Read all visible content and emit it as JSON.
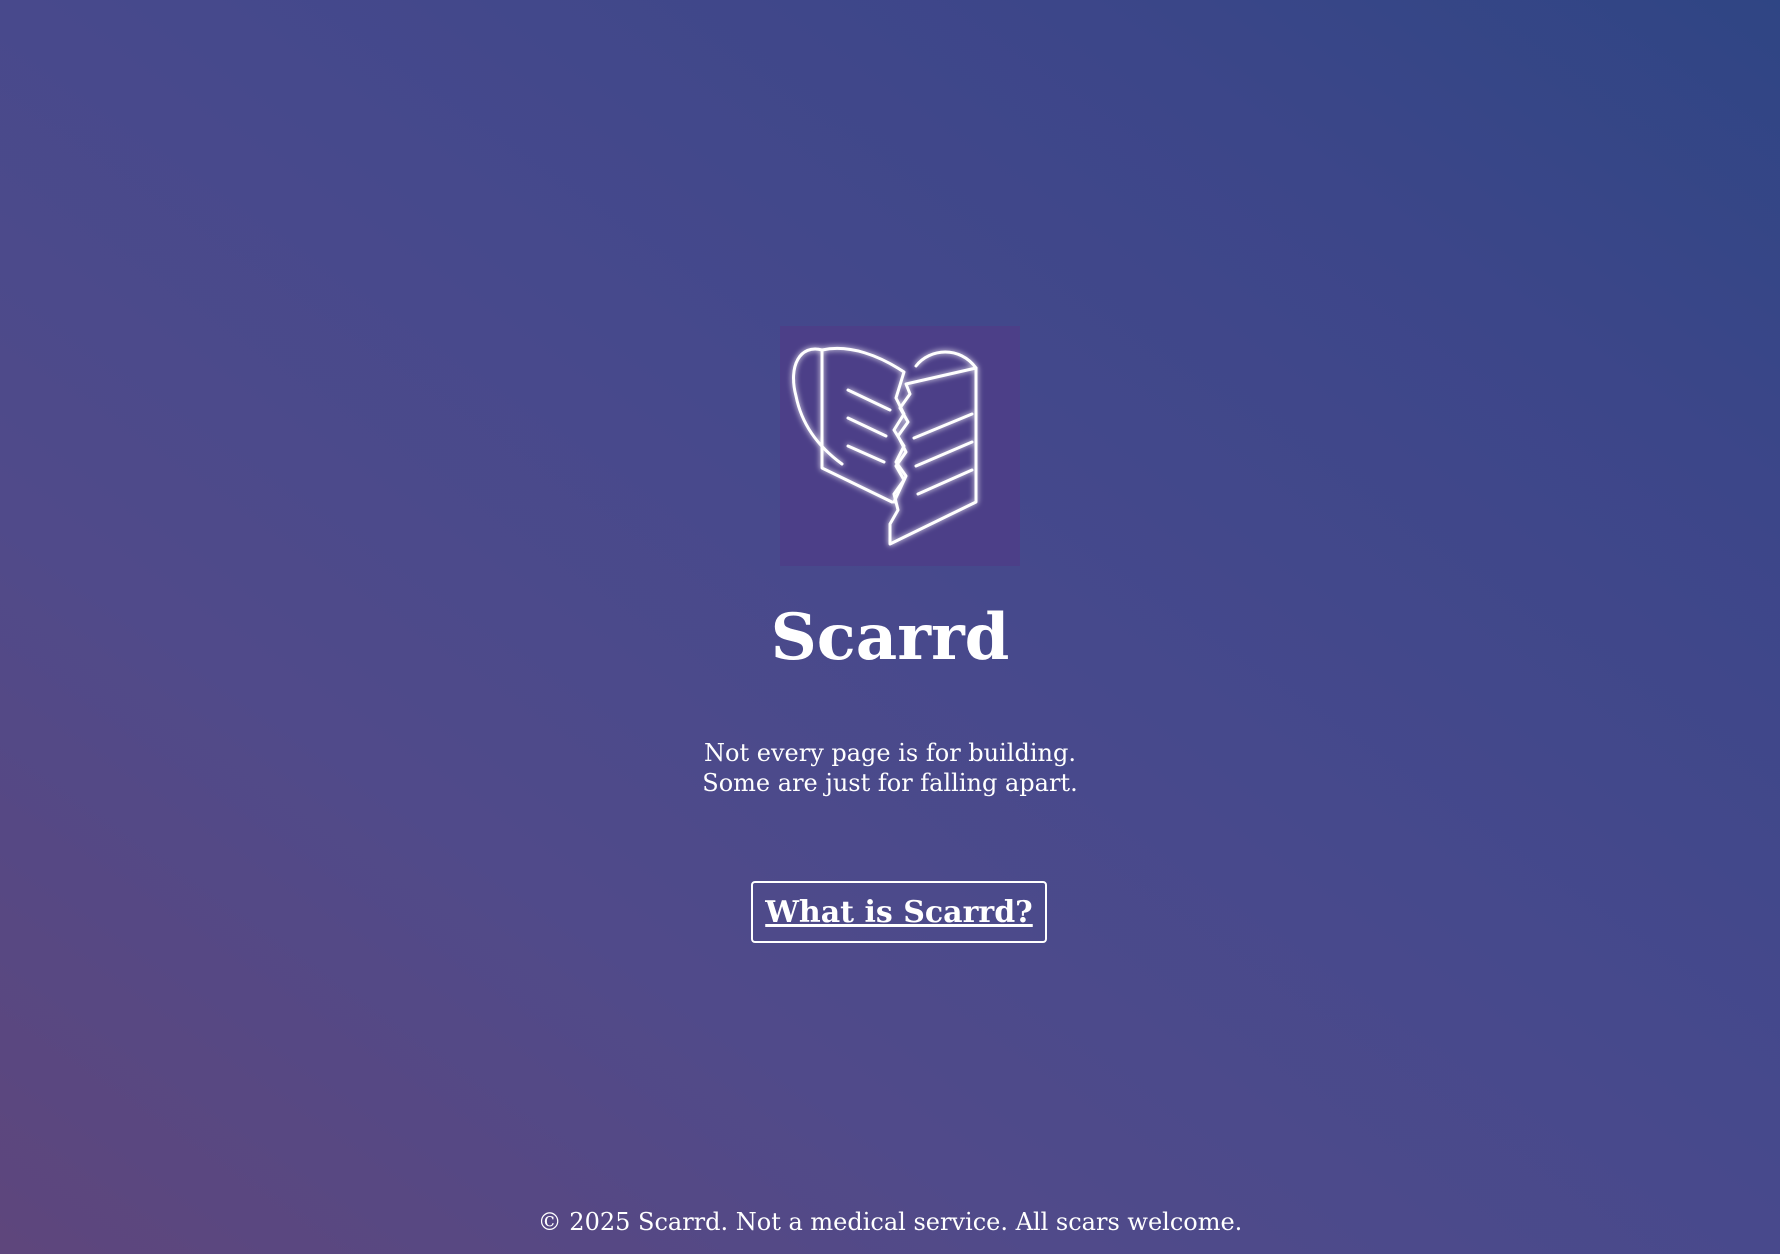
{
  "brand": {
    "logo_icon": "broken-heart-book-icon",
    "title": "Scarrd"
  },
  "tagline": {
    "line1": "Not every page is for building.",
    "line2": "Some are just for falling apart."
  },
  "cta": {
    "label": "What is Scarrd?"
  },
  "footer": {
    "text": "© 2025 Scarrd. Not a medical service. All scars welcome."
  },
  "colors": {
    "background_start": "#5e467c",
    "background_end": "#2f4584",
    "logo_background": "#4c3f88",
    "text": "#ffffff"
  }
}
